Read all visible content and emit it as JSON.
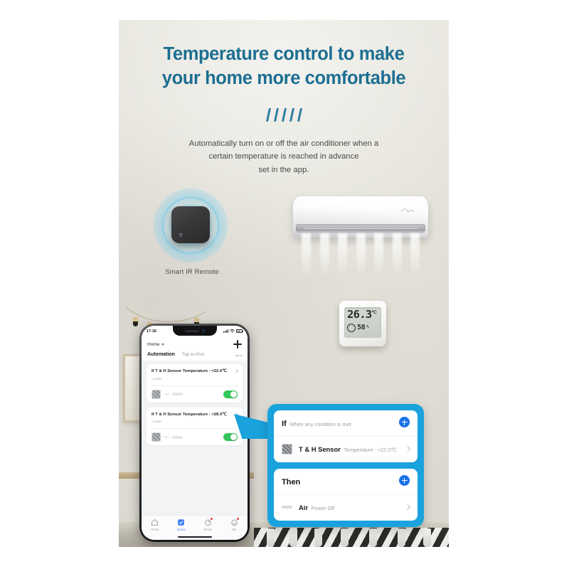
{
  "headline": {
    "line1": "Temperature control to make",
    "line2": "your home more comfortable",
    "color": "#1d6f92",
    "tick_count": 5
  },
  "subhead": {
    "line1": "Automatically turn on or off the air conditioner when a",
    "line2": "certain temperature is reached in advance",
    "line3": "set in the app."
  },
  "ir_remote": {
    "label": "Smart IR Remote"
  },
  "sensor": {
    "temperature": "26.3",
    "temperature_unit": "℃",
    "humidity": "58",
    "humidity_unit": "%",
    "icon": "smiley-face-icon"
  },
  "phone": {
    "status": {
      "time": "17:18",
      "location_icon": "location-arrow-icon",
      "signal_icon": "signal-bars-icon",
      "wifi_icon": "wifi-icon",
      "battery_icon": "battery-icon"
    },
    "header": {
      "home_label": "Home",
      "add_label": "add-icon"
    },
    "tabs": [
      {
        "label": "Automation",
        "active": true
      },
      {
        "label": "Tap-to-Run",
        "active": false
      }
    ],
    "automations": [
      {
        "title": "If T & H Sensor Temperature : <22.0℃",
        "sub": "1 tasks",
        "enabled": true
      },
      {
        "title": "If T & H Sensor Temperature : >28.0℃",
        "sub": "1 tasks",
        "enabled": true
      }
    ],
    "nav": [
      {
        "label": "Home",
        "icon": "home-icon",
        "active": false,
        "badge": false
      },
      {
        "label": "Scene",
        "icon": "scene-icon",
        "active": true,
        "badge": false
      },
      {
        "label": "Smart",
        "icon": "smart-icon",
        "active": false,
        "badge": true
      },
      {
        "label": "Me",
        "icon": "me-icon",
        "active": false,
        "badge": true
      }
    ]
  },
  "callout": {
    "accent_color": "#1aa2dd",
    "if_card": {
      "title": "If",
      "subtitle": "When any condition is met",
      "add_icon": "plus-icon",
      "device_name": "T & H Sensor",
      "device_detail": "Temperature : <22.0℃"
    },
    "then_card": {
      "title": "Then",
      "add_icon": "plus-icon",
      "device_name": "Air",
      "device_detail": "Power Off"
    }
  }
}
